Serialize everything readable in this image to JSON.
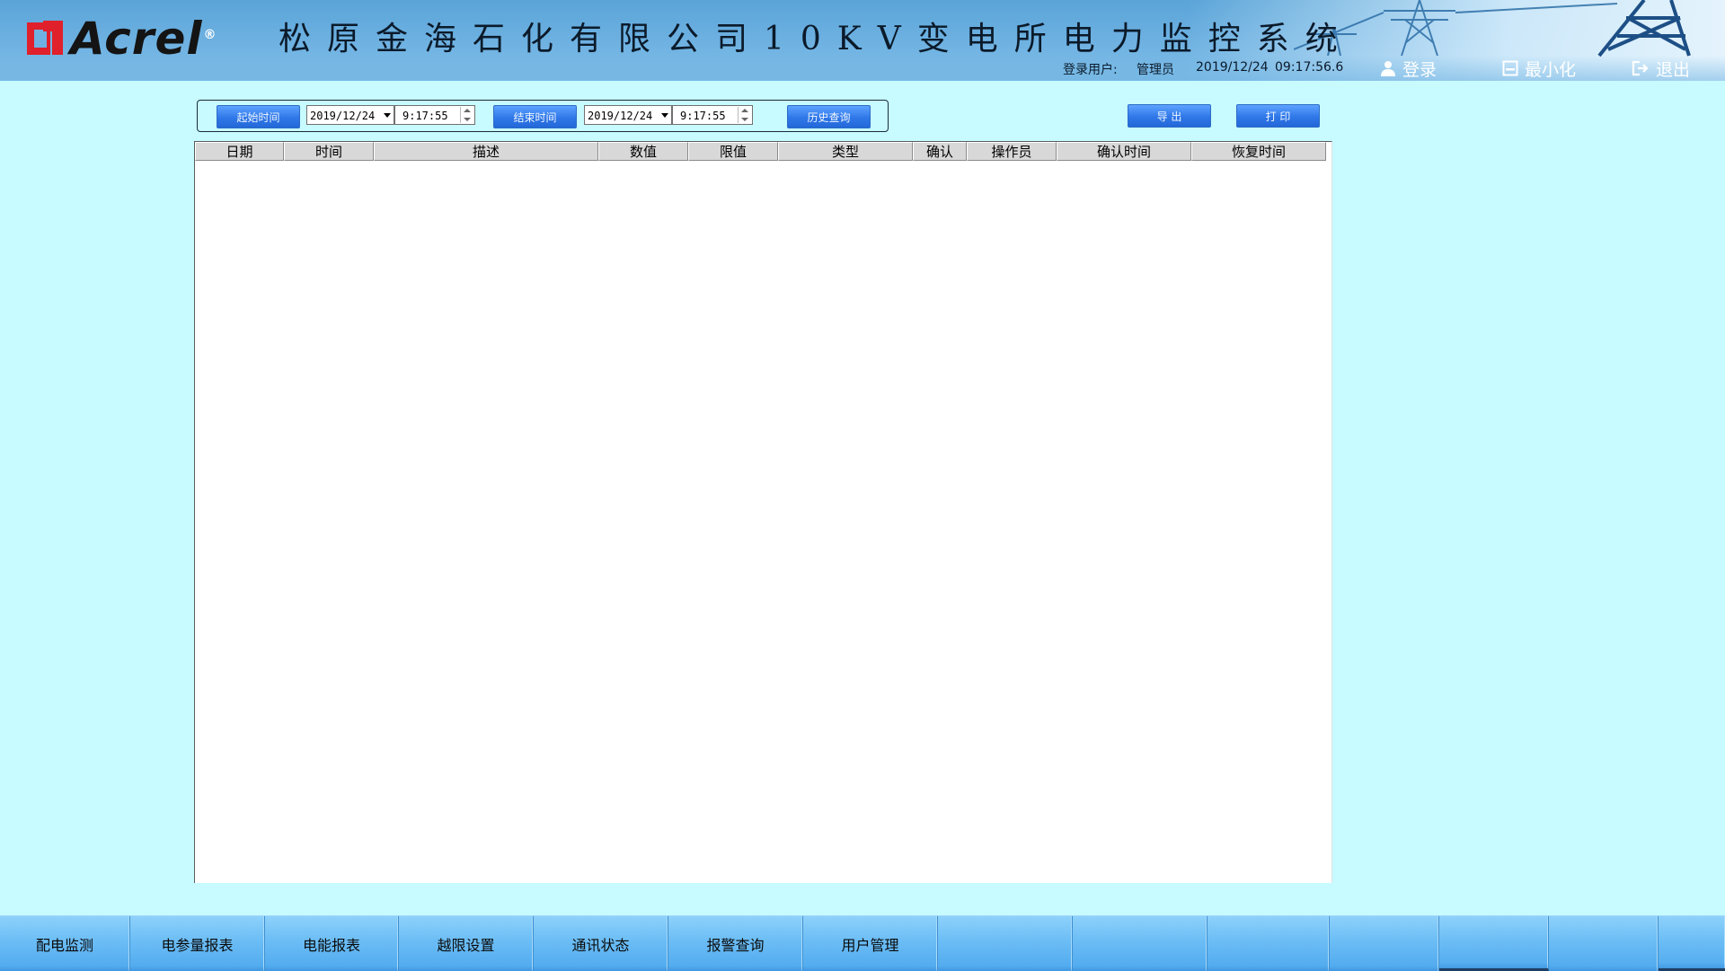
{
  "header": {
    "logo_text": "Acrel",
    "logo_reg": "®",
    "title": "松原金海石化有限公司10KV变电所电力监控系统",
    "login_user_label": "登录用户:",
    "login_user": "管理员",
    "date": "2019/12/24",
    "time": "09:17:56.6",
    "login_label": "登录",
    "minimize_label": "最小化",
    "exit_label": "退出"
  },
  "query": {
    "start_label": "起始时间",
    "start_date": "2019/12/24",
    "start_time": "9:17:55",
    "end_label": "结束时间",
    "end_date": "2019/12/24",
    "end_time": "9:17:55",
    "history_label": "历史查询",
    "export_label": "导 出",
    "print_label": "打 印"
  },
  "table": {
    "columns": [
      "日期",
      "时间",
      "描述",
      "数值",
      "限值",
      "类型",
      "确认",
      "操作员",
      "确认时间",
      "恢复时间"
    ],
    "rows": []
  },
  "nav": {
    "items": [
      "配电监测",
      "电参量报表",
      "电能报表",
      "越限设置",
      "通讯状态",
      "报警查询",
      "用户管理",
      "",
      "",
      "",
      "",
      "",
      "",
      ""
    ]
  },
  "colors": {
    "background": "#c8fbff",
    "header": "#6fb2e2",
    "button": "#2f77e8",
    "footer": "#6bbdf5"
  }
}
